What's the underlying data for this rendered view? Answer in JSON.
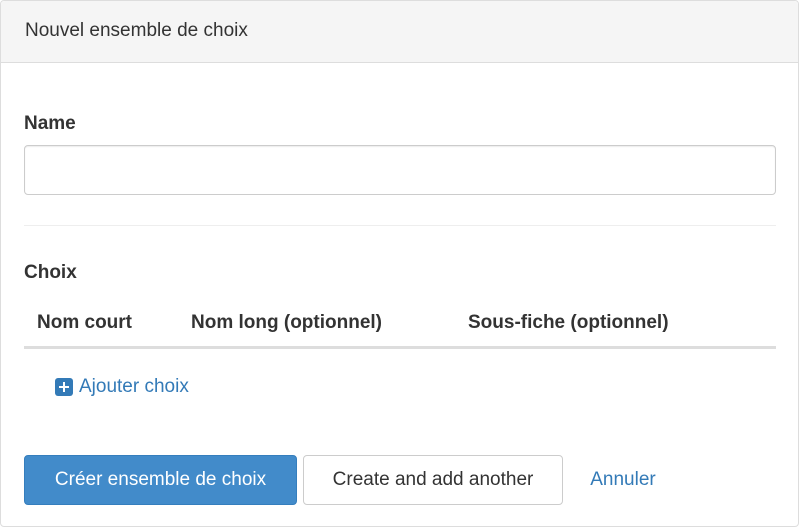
{
  "panel": {
    "title": "Nouvel ensemble de choix"
  },
  "form": {
    "name_label": "Name",
    "name_value": "",
    "name_placeholder": "",
    "choices_label": "Choix",
    "columns": [
      "Nom court",
      "Nom long (optionnel)",
      "Sous-fiche (optionnel)"
    ],
    "add_choice_label": "Ajouter choix",
    "add_choice_icon": "plus-square-icon"
  },
  "actions": {
    "create_label": "Créer ensemble de choix",
    "create_another_label": "Create and add another",
    "cancel_label": "Annuler"
  },
  "colors": {
    "primary": "#428bca",
    "link": "#337ab7",
    "heading_bg": "#f5f5f5",
    "border": "#dddddd"
  }
}
